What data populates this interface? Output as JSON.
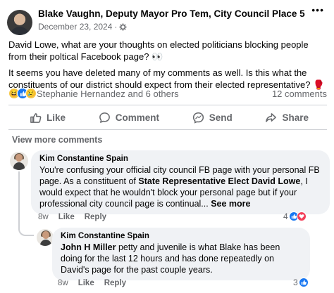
{
  "post": {
    "author": "Blake Vaughn, Deputy Mayor Pro Tem, City Council Place 5",
    "date": "December 23, 2024",
    "separator": "·",
    "more": "•••",
    "paragraph1": "David Lowe, what are your thoughts on elected politicians blocking people from their poltical Facebook page? 👀",
    "paragraph2": "It seems you have deleted many of my comments as well. Is this what the constituents of our district should expect from their elected representative? 🥊",
    "reactions_names": "Stephanie Hernandez and 6 others",
    "comment_count": "12 comments"
  },
  "actions": {
    "like": "Like",
    "comment": "Comment",
    "send": "Send",
    "share": "Share"
  },
  "comments": {
    "view_more": "View more comments",
    "first": {
      "author": "Kim Constantine Spain",
      "text_a": "You're confusing your official city council FB page with your personal FB page. As a constituent of ",
      "text_bold": "State Representative Elect David Lowe",
      "text_b": ", I would expect that he wouldn't block your personal page but if your professional city council page is continual... ",
      "see_more": "See more",
      "age": "8w",
      "like": "Like",
      "reply": "Reply",
      "reaction_count": "4"
    },
    "second": {
      "author": "Kim Constantine Spain",
      "mention": "John H Miller",
      "text": " petty and juvenile is what Blake has been doing for the last 12 hours and has done repeatedly on David's page for the past couple years.",
      "age": "8w",
      "like": "Like",
      "reply": "Reply",
      "reaction_count": "3"
    }
  },
  "colors": {
    "accent": "#1877f2",
    "muted": "#65676b",
    "bubble": "#f0f2f5",
    "love": "#f33e58"
  }
}
